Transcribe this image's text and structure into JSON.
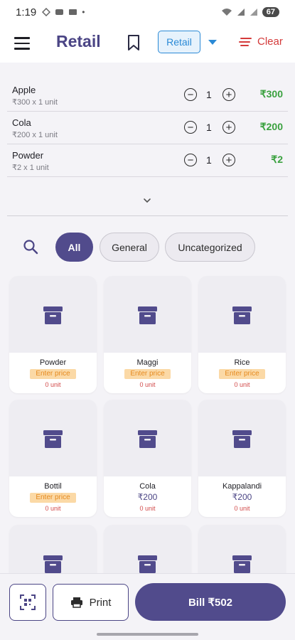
{
  "status_bar": {
    "time": "1:19",
    "battery": "67"
  },
  "app_bar": {
    "title": "Retail",
    "mode": "Retail",
    "clear_label": "Clear"
  },
  "cart": {
    "items": [
      {
        "name": "Apple",
        "detail": "₹300 x 1 unit",
        "qty": "1",
        "total": "₹300"
      },
      {
        "name": "Cola",
        "detail": "₹200 x 1 unit",
        "qty": "1",
        "total": "₹200"
      },
      {
        "name": "Powder",
        "detail": "₹2 x 1 unit",
        "qty": "1",
        "total": "₹2"
      }
    ]
  },
  "filters": {
    "chips": [
      "All",
      "General",
      "Uncategorized"
    ],
    "selected": "All"
  },
  "products": [
    {
      "name": "Powder",
      "price_label": "Enter price",
      "units": "0 unit"
    },
    {
      "name": "Maggi",
      "price_label": "Enter price",
      "units": "0 unit"
    },
    {
      "name": "Rice",
      "price_label": "Enter price",
      "units": "0 unit"
    },
    {
      "name": "Bottil",
      "price_label": "Enter price",
      "units": "0 unit"
    },
    {
      "name": "Cola",
      "price": "₹200",
      "units": "0 unit"
    },
    {
      "name": "Kappalandi",
      "price": "₹200",
      "units": "0 unit"
    }
  ],
  "bottom_bar": {
    "print_label": "Print",
    "bill_label": "Bill ₹502"
  },
  "colors": {
    "primary": "#514b8c",
    "accent_blue": "#2b8ad6",
    "danger": "#d43a3a",
    "success": "#3aa13f",
    "price_badge_bg": "#fbd9a6",
    "price_badge_text": "#e58a1f"
  }
}
